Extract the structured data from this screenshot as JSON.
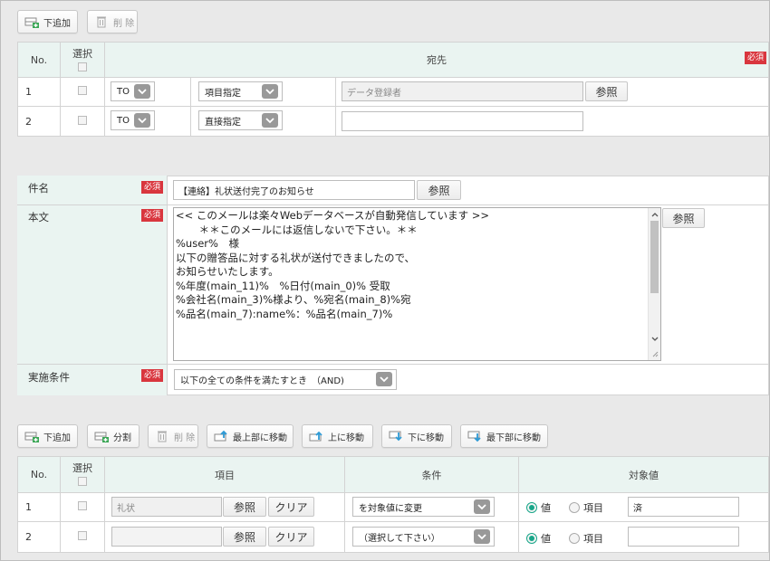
{
  "top_toolbar": {
    "add_below": "下追加",
    "delete": "削 除"
  },
  "dest_table": {
    "col_no": "No.",
    "col_select": "選択",
    "col_dest": "宛先",
    "required": "必須",
    "rows": [
      {
        "no": "1",
        "type": "TO",
        "mode": "項目指定",
        "value": "",
        "placeholder": "データ登録者",
        "ref": "参照"
      },
      {
        "no": "2",
        "type": "TO",
        "mode": "直接指定",
        "value": "",
        "placeholder": ""
      }
    ]
  },
  "mail_form": {
    "subject_label": "件名",
    "subject_value": "【連絡】礼状送付完了のお知らせ",
    "subject_ref": "参照",
    "body_label": "本文",
    "body_ref": "参照",
    "body_lines": [
      "<< このメールは楽々Webデータベースが自動発信しています >>",
      "       ＊＊このメールには返信しないで下さい。＊＊",
      "",
      "%user%　様",
      "",
      "以下の贈答品に対する礼状が送付できましたので、",
      "お知らせいたします。",
      "",
      "%年度(main_11)%　%日付(main_0)% 受取",
      "%会社名(main_3)%様より、%宛名(main_8)%宛",
      "%品名(main_7):name%：%品名(main_7)%"
    ],
    "condition_label": "実施条件",
    "condition_value": "以下の全ての条件を満たすとき　（AND)",
    "required": "必須"
  },
  "bottom_toolbar": {
    "add_below": "下追加",
    "split": "分割",
    "delete": "削 除",
    "move_top": "最上部に移動",
    "move_up": "上に移動",
    "move_down": "下に移動",
    "move_bottom": "最下部に移動"
  },
  "cond_table": {
    "col_no": "No.",
    "col_select": "選択",
    "col_item": "項目",
    "col_condition": "条件",
    "col_target": "対象値",
    "ref": "参照",
    "clear": "クリア",
    "radio_value": "値",
    "radio_item": "項目",
    "rows": [
      {
        "no": "1",
        "item": "礼状",
        "condition": "を対象値に変更",
        "target": "済"
      },
      {
        "no": "2",
        "item": "",
        "condition": "（選択して下さい）",
        "target": ""
      }
    ]
  }
}
